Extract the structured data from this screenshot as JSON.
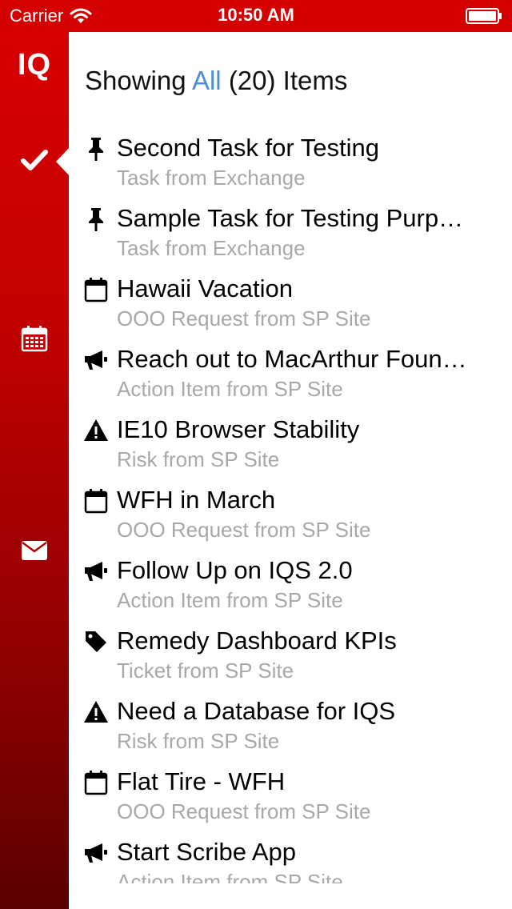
{
  "status_bar": {
    "carrier": "Carrier",
    "time": "10:50 AM"
  },
  "sidebar": {
    "logo": "IQ",
    "nav": [
      {
        "name": "tasks",
        "icon": "checkmark-icon",
        "selected": true
      },
      {
        "name": "calendar",
        "icon": "calendar-icon",
        "selected": false
      },
      {
        "name": "mail",
        "icon": "envelope-icon",
        "selected": false
      }
    ]
  },
  "header": {
    "prefix": "Showing",
    "filter": "All",
    "count": "(20)",
    "suffix": "Items"
  },
  "colors": {
    "brand_red": "#d40000",
    "link_blue": "#4a90d9",
    "subtitle_gray": "#a8a8a8"
  },
  "items": [
    {
      "icon": "pushpin-icon",
      "title": "Second Task for Testing",
      "subtitle": "Task from Exchange"
    },
    {
      "icon": "pushpin-icon",
      "title": "Sample Task for Testing Purp…",
      "subtitle": "Task from Exchange"
    },
    {
      "icon": "calendar-icon",
      "title": "Hawaii Vacation",
      "subtitle": "OOO Request from SP Site"
    },
    {
      "icon": "megaphone-icon",
      "title": "Reach out to MacArthur Foun…",
      "subtitle": "Action Item from SP Site"
    },
    {
      "icon": "warning-icon",
      "title": "IE10 Browser Stability",
      "subtitle": "Risk from SP Site"
    },
    {
      "icon": "calendar-icon",
      "title": "WFH in March",
      "subtitle": "OOO Request from SP Site"
    },
    {
      "icon": "megaphone-icon",
      "title": "Follow Up on IQS 2.0",
      "subtitle": "Action Item from SP Site"
    },
    {
      "icon": "tag-icon",
      "title": "Remedy Dashboard KPIs",
      "subtitle": "Ticket from SP Site"
    },
    {
      "icon": "warning-icon",
      "title": "Need a Database for IQS",
      "subtitle": "Risk from SP Site"
    },
    {
      "icon": "calendar-icon",
      "title": "Flat Tire - WFH",
      "subtitle": "OOO Request from SP Site"
    },
    {
      "icon": "megaphone-icon",
      "title": "Start Scribe App",
      "subtitle": "Action Item from SP Site"
    }
  ]
}
